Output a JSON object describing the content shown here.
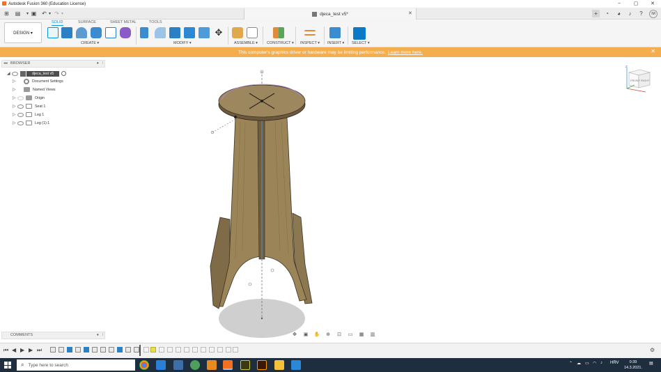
{
  "window": {
    "title": "Autodesk Fusion 360 (Education License)",
    "minimize": "−",
    "maximize": "▢",
    "close": "✕"
  },
  "doc_tab": {
    "title": "djeca_test v5*",
    "close": "✕"
  },
  "ribbon": {
    "workspace": "DESIGN ▾",
    "tabs": [
      "SOLID",
      "SURFACE",
      "SHEET METAL",
      "TOOLS"
    ],
    "groups": [
      "CREATE ▾",
      "MODIFY ▾",
      "ASSEMBLE ▾",
      "CONSTRUCT ▾",
      "INSPECT ▾",
      "INSERT ▾",
      "SELECT ▾"
    ]
  },
  "banner": {
    "text": "This computer's graphics driver or hardware may be limiting performance.",
    "link": "Learn more here."
  },
  "browser": {
    "title": "BROWSER",
    "root": "djeca_test v5",
    "items": [
      "Document Settings",
      "Named Views",
      "Origin",
      "Seat 1",
      "Leg 1",
      "Leg (1):1"
    ]
  },
  "comments": {
    "title": "COMMENTS"
  },
  "viewcube": {
    "front": "FRONT",
    "right": "RIGHT",
    "z": "Z",
    "x": "X",
    "y": "Y"
  },
  "user": {
    "initials": "IM"
  },
  "taskbar": {
    "search_placeholder": "Type here to search",
    "lang": "HRV",
    "time": "0:39",
    "date": "14.3.2021."
  },
  "colors": {
    "accent": "#0696d7",
    "banner": "#f5ae4d",
    "wood": "#8a7650",
    "taskbar": "#1f2e3f"
  }
}
